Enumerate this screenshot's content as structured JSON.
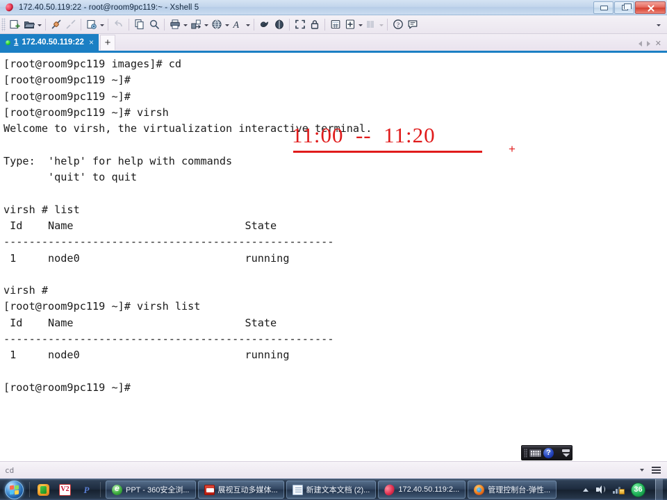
{
  "window": {
    "title": "172.40.50.119:22 - root@room9pc119:~ - Xshell 5",
    "app_icon": "xshell-shell-icon",
    "controls": {
      "minimize": "minimize-button",
      "restore": "restore-button",
      "close": "close-button"
    }
  },
  "toolbar": {
    "items": [
      {
        "name": "new-session-icon",
        "caret": false,
        "dim": false
      },
      {
        "name": "open-folder-icon",
        "caret": true,
        "dim": false
      },
      {
        "name": "connect-icon",
        "caret": false,
        "dim": false
      },
      {
        "name": "disconnect-icon",
        "caret": false,
        "dim": true
      },
      {
        "name": "properties-gear-icon",
        "caret": true,
        "dim": false
      },
      {
        "name": "undo-icon",
        "caret": false,
        "dim": true
      },
      {
        "name": "copy-icon",
        "caret": false,
        "dim": false
      },
      {
        "name": "find-icon",
        "caret": false,
        "dim": false
      },
      {
        "name": "print-icon",
        "caret": true,
        "dim": false
      },
      {
        "name": "transfer-file-icon",
        "caret": true,
        "dim": false
      },
      {
        "name": "globe-icon",
        "caret": true,
        "dim": false
      },
      {
        "name": "font-icon",
        "caret": true,
        "dim": false
      },
      {
        "name": "compose-bar-icon",
        "caret": false,
        "dim": false
      },
      {
        "name": "highlight-icon",
        "caret": false,
        "dim": false
      },
      {
        "name": "fullscreen-icon",
        "caret": false,
        "dim": false
      },
      {
        "name": "lock-icon",
        "caret": false,
        "dim": false
      },
      {
        "name": "calculator-icon",
        "caret": false,
        "dim": false
      },
      {
        "name": "add-note-icon",
        "caret": true,
        "dim": false
      },
      {
        "name": "layout-icon",
        "caret": true,
        "dim": true
      },
      {
        "name": "help-icon",
        "caret": false,
        "dim": false
      },
      {
        "name": "chat-icon",
        "caret": false,
        "dim": false
      }
    ],
    "overflow_caret": "toolbar-overflow-caret"
  },
  "tabs": {
    "active": {
      "number": "1",
      "label": "172.40.50.119:22",
      "close_label": "×",
      "status": "connected"
    },
    "new_tab_label": "+",
    "nav_close_label": "✕"
  },
  "terminal": {
    "lines": [
      "[root@room9pc119 images]# cd",
      "[root@room9pc119 ~]#",
      "[root@room9pc119 ~]#",
      "[root@room9pc119 ~]# virsh",
      "Welcome to virsh, the virtualization interactive terminal.",
      "",
      "Type:  'help' for help with commands",
      "       'quit' to quit",
      "",
      "virsh # list",
      " Id    Name                           State",
      "----------------------------------------------------",
      " 1     node0                          running",
      "",
      "virsh # ",
      "[root@room9pc119 ~]# virsh list",
      " Id    Name                           State",
      "----------------------------------------------------",
      " 1     node0                          running",
      "",
      "[root@room9pc119 ~]# "
    ],
    "foreground_color": "#1a1a1a",
    "background_color": "#ffffff"
  },
  "annotation": {
    "text": "11:00  --  11:20",
    "plus_mark": "+",
    "color": "#e01b1b",
    "underlined": true
  },
  "mini_toolbar": {
    "keyboard_icon": "onscreen-keyboard-icon",
    "help_label": "?",
    "collapse_icon": "collapse-arrows-icon"
  },
  "statusbar": {
    "text": "cd",
    "caret_icon": "status-dropdown-caret",
    "menu_icon": "status-menu-icon"
  },
  "taskbar": {
    "start_label": "Start",
    "quick_launch": [
      {
        "name": "quicklaunch-360-icon",
        "glyph": "360"
      },
      {
        "name": "quicklaunch-v2-icon",
        "glyph": "V2"
      },
      {
        "name": "quicklaunch-p-icon",
        "glyph": "P"
      }
    ],
    "tasks": [
      {
        "name": "taskbar-item-ppt-browser",
        "label": "PPT - 360安全浏...",
        "icon": "ie-browser-icon"
      },
      {
        "name": "taskbar-item-zhanshi",
        "label": "展视互动多媒体...",
        "icon": "red-app-icon"
      },
      {
        "name": "taskbar-item-textdoc",
        "label": "新建文本文档 (2)...",
        "icon": "text-document-icon"
      },
      {
        "name": "taskbar-item-xshell",
        "label": "172.40.50.119:2...",
        "icon": "xshell-shell-icon"
      },
      {
        "name": "taskbar-item-console",
        "label": "管理控制台-弹性...",
        "icon": "firefox-icon"
      }
    ],
    "tray": {
      "overflow_icon": "tray-overflow-caret",
      "volume_icon": "volume-icon",
      "network_icon": "network-warning-icon",
      "badge_label": "36"
    }
  }
}
